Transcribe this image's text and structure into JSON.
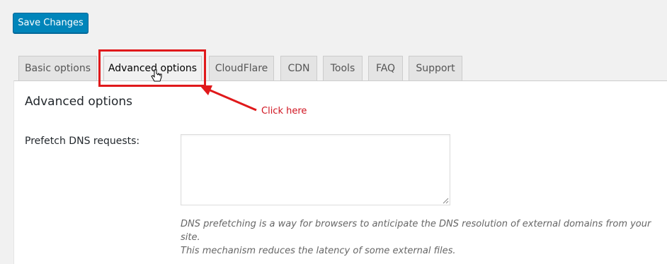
{
  "toolbar": {
    "save_label": "Save Changes"
  },
  "tabs": [
    {
      "label": "Basic options",
      "active": false
    },
    {
      "label": "Advanced options",
      "active": true
    },
    {
      "label": "CloudFlare",
      "active": false
    },
    {
      "label": "CDN",
      "active": false
    },
    {
      "label": "Tools",
      "active": false
    },
    {
      "label": "FAQ",
      "active": false
    },
    {
      "label": "Support",
      "active": false
    }
  ],
  "panel": {
    "title": "Advanced options",
    "prefetch_label": "Prefetch DNS requests:",
    "prefetch_value": "",
    "description_line1": "DNS prefetching is a way for browsers to anticipate the DNS resolution of external domains from your site.",
    "description_line2": "This mechanism reduces the latency of some external files."
  },
  "annotation": {
    "text": "Click here",
    "color": "#d0131f"
  },
  "colors": {
    "primary_button": "#0085ba",
    "highlight": "#e0191b"
  },
  "icons": {
    "cursor": "hand-pointer-icon",
    "resize": "resize-grip-icon"
  }
}
